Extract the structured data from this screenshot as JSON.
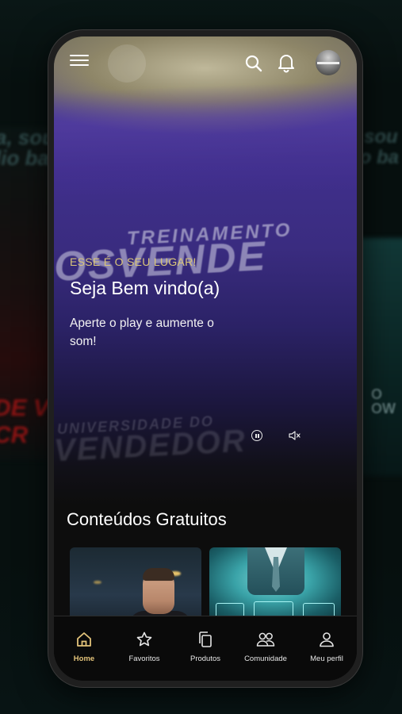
{
  "hero": {
    "eyebrow": "ESSE É O SEU LUGAR!",
    "title": "Seja Bem vindo(a)",
    "subtitle": "Aperte o play e aumente o som!",
    "background_text": [
      "TREINAMENTO",
      "OSVENDE",
      "UNIVERSIDADE DO",
      "VENDEDOR"
    ]
  },
  "background_text": {
    "left_top": "a, sou\nlio ba",
    "left_red": "DE VE\nCR",
    "right_top": "a, sou\nulo ba",
    "right_mid": "O\nOW"
  },
  "section": {
    "title": "Conteúdos Gratuitos"
  },
  "nav": {
    "items": [
      {
        "label": "Home",
        "icon": "home-icon",
        "active": true
      },
      {
        "label": "Favoritos",
        "icon": "star-icon",
        "active": false
      },
      {
        "label": "Produtos",
        "icon": "copy-icon",
        "active": false
      },
      {
        "label": "Comunidade",
        "icon": "users-icon",
        "active": false
      },
      {
        "label": "Meu perfil",
        "icon": "user-icon",
        "active": false
      }
    ]
  },
  "colors": {
    "accent": "#e3c37a",
    "eyebrow": "#d8c479",
    "hero_purple": "#3f2f8a",
    "background": "#0d0d0d"
  },
  "topbar": {
    "icons": [
      "menu-icon",
      "logo",
      "search-icon",
      "bell-icon",
      "avatar"
    ]
  }
}
